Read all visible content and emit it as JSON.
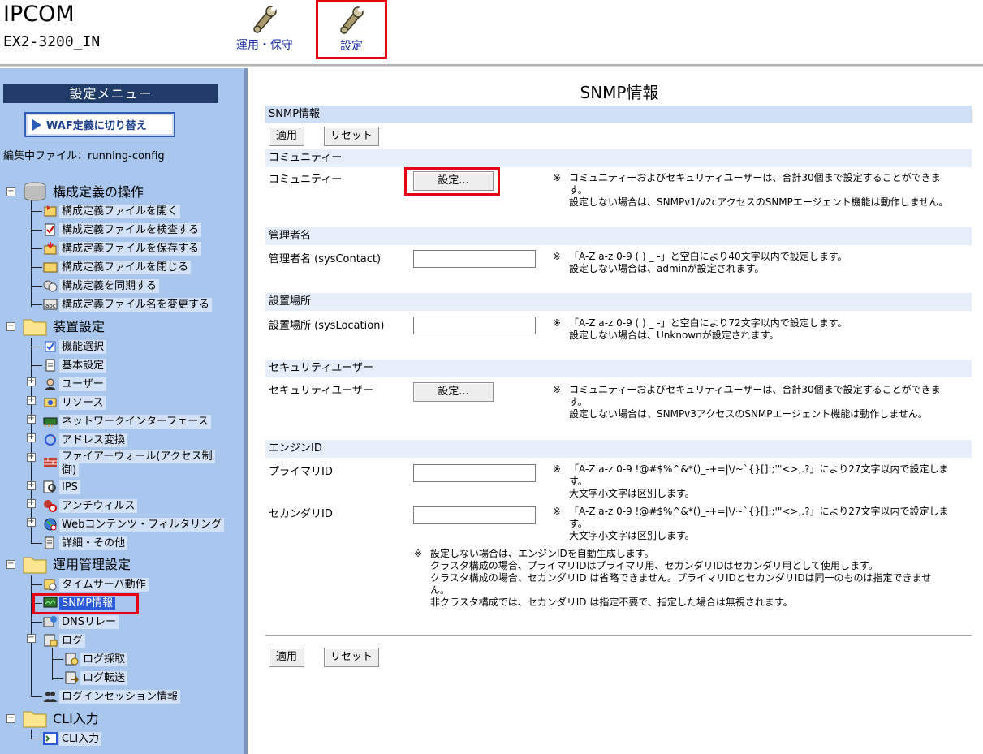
{
  "header": {
    "brand": "IPCOM",
    "model": "EX2-3200_IN",
    "nav": [
      {
        "label": "運用・保守",
        "icon": "wrench-icon"
      },
      {
        "label": "設定",
        "icon": "wrench-icon",
        "active": true
      }
    ]
  },
  "sidebar": {
    "menu_title": "設定メニュー",
    "waf_button": "WAF定義に切り替え",
    "edit_file": "編集中ファイル：running-config",
    "groups": [
      {
        "label": "構成定義の操作",
        "items": [
          "構成定義ファイルを開く",
          "構成定義ファイルを検査する",
          "構成定義ファイルを保存する",
          "構成定義ファイルを閉じる",
          "構成定義を同期する",
          "構成定義ファイル名を変更する"
        ]
      },
      {
        "label": "装置設定",
        "items": [
          "機能選択",
          "基本設定",
          "ユーザー",
          "リソース",
          "ネットワークインターフェース",
          "アドレス変換",
          "ファイアーウォール(アクセス制",
          "御)",
          "IPS",
          "アンチウィルス",
          "Webコンテンツ・フィルタリング",
          "詳細・その他"
        ]
      },
      {
        "label": "運用管理設定",
        "items": [
          "タイムサーバ動作",
          "SNMP情報",
          "DNSリレー",
          "ログ",
          "ログ採取",
          "ログ転送",
          "ログインセッション情報"
        ]
      },
      {
        "label": "CLI入力",
        "items": [
          "CLI入力"
        ]
      }
    ]
  },
  "main": {
    "title": "SNMP情報",
    "section_snmp": "SNMP情報",
    "apply": "適用",
    "reset": "リセット",
    "community": {
      "section": "コミュニティー",
      "label": "コミュニティー",
      "button": "設定...",
      "note_mark": "※",
      "note": [
        "コミュニティーおよびセキュリティユーザーは、合計30個まで設定することができま",
        "す。",
        "設定しない場合は、SNMPv1/v2cアクセスのSNMPエージェント機能は動作しません。"
      ]
    },
    "contact": {
      "section": "管理者名",
      "label": "管理者名 (sysContact)",
      "value": "",
      "note_mark": "※",
      "note": [
        "「A-Z a-z 0-9 ( ) _ -」と空白により40文字以内で設定します。",
        "設定しない場合は、adminが設定されます。"
      ]
    },
    "location": {
      "section": "設置場所",
      "label": "設置場所 (sysLocation)",
      "value": "",
      "note_mark": "※",
      "note": [
        "「A-Z a-z 0-9 ( ) _ -」と空白により72文字以内で設定します。",
        "設定しない場合は、Unknownが設定されます。"
      ]
    },
    "security": {
      "section": "セキュリティユーザー",
      "label": "セキュリティユーザー",
      "button": "設定...",
      "note_mark": "※",
      "note": [
        "コミュニティーおよびセキュリティユーザーは、合計30個まで設定することができま",
        "す。",
        "設定しない場合は、SNMPv3アクセスのSNMPエージェント機能は動作しません。"
      ]
    },
    "engine": {
      "section": "エンジンID",
      "primary_label": "プライマリID",
      "primary_value": "",
      "secondary_label": "セカンダリID",
      "secondary_value": "",
      "note_mark": "※",
      "primary_note": [
        "「A-Z a-z 0-9 !@#$%^&*()_-+=|\\/~`{}[]:;'\"<>,.?」により27文字以内で設定しま",
        "す。",
        "大文字小文字は区別します。"
      ],
      "secondary_note": [
        "「A-Z a-z 0-9 !@#$%^&*()_-+=|\\/~`{}[]:;'\"<>,.?」により27文字以内で設定しま",
        "す。",
        "大文字小文字は区別します。"
      ],
      "footnote": [
        "設定しない場合は、エンジンIDを自動生成します。",
        "クラスタ構成の場合、プライマリIDはプライマリ用、セカンダリIDはセカンダリ用として使用します。",
        "クラスタ構成の場合、セカンダリID は省略できません。プライマリIDとセカンダリIDは同一のものは指定できませ",
        "ん。",
        "非クラスタ構成では、セカンダリID は指定不要で、指定した場合は無視されます。"
      ]
    }
  }
}
